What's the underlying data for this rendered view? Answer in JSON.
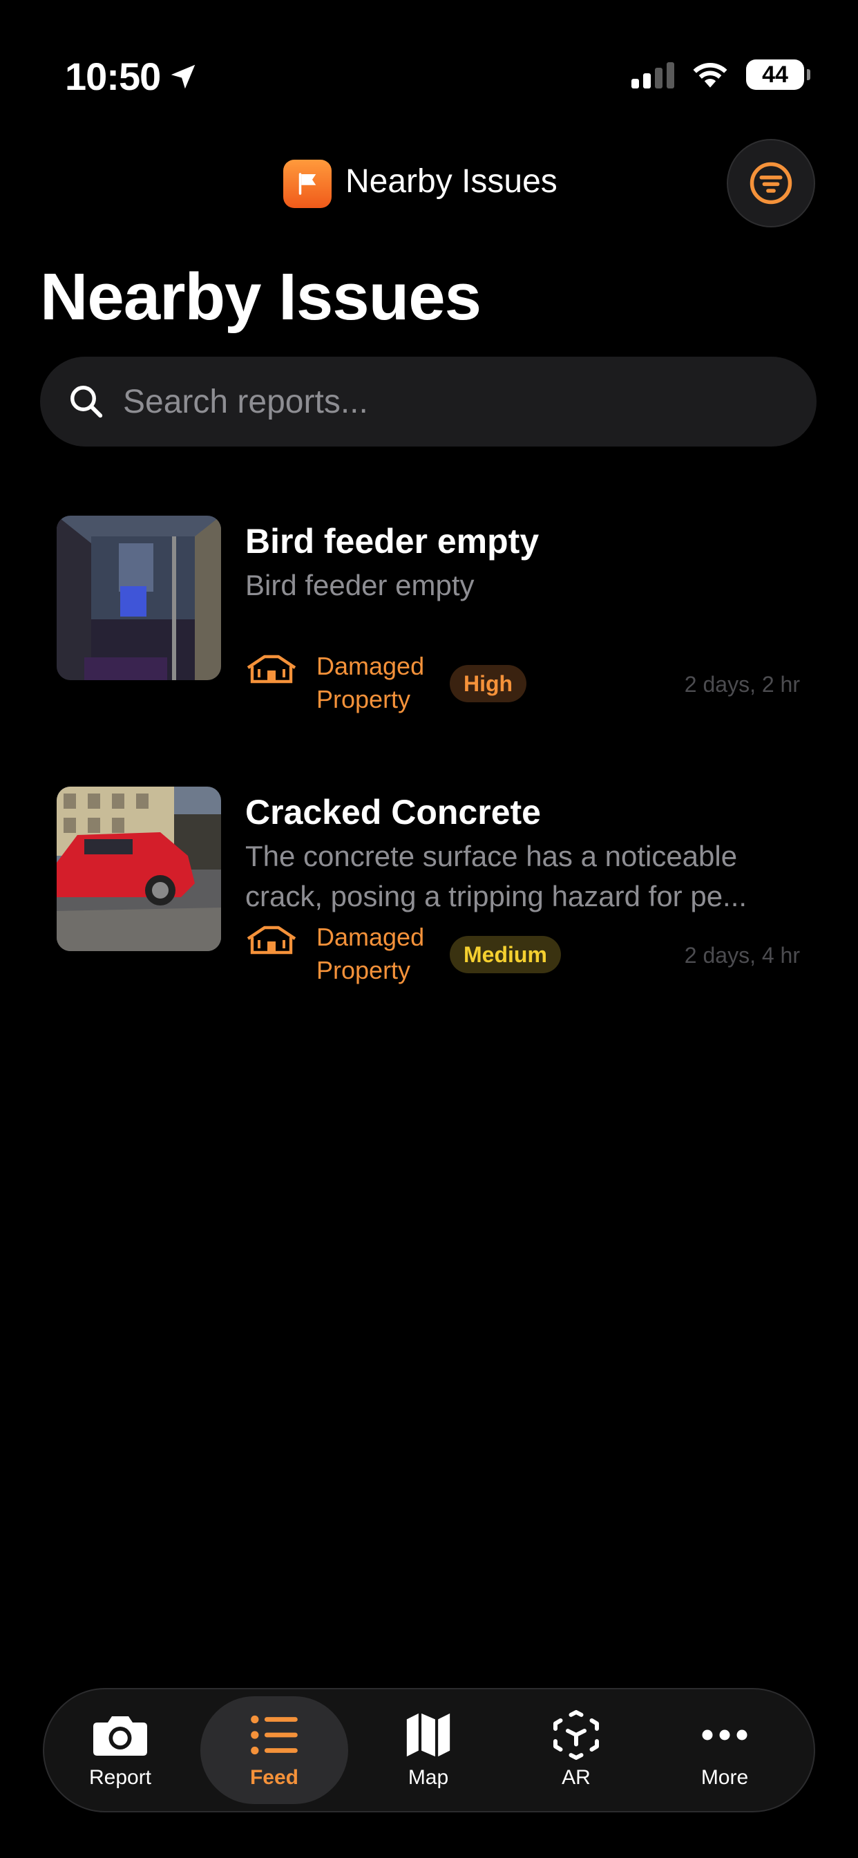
{
  "status_bar": {
    "time": "10:50",
    "battery": "44"
  },
  "header": {
    "nav_title": "Nearby Issues",
    "large_title": "Nearby Issues"
  },
  "search": {
    "placeholder": "Search reports..."
  },
  "reports": [
    {
      "title": "Bird feeder empty",
      "description": "Bird feeder empty",
      "category": "Damaged Property",
      "priority": "High",
      "time_ago": "2 days, 2 hr"
    },
    {
      "title": "Cracked Concrete",
      "description": "The concrete surface has a noticeable crack, posing a tripping hazard for pe...",
      "category": "Damaged Property",
      "priority": "Medium",
      "time_ago": "2 days, 4 hr"
    }
  ],
  "tab_bar": {
    "tabs": [
      {
        "label": "Report",
        "icon": "camera-icon"
      },
      {
        "label": "Feed",
        "icon": "list-icon",
        "active": true
      },
      {
        "label": "Map",
        "icon": "map-icon"
      },
      {
        "label": "AR",
        "icon": "ar-cube-icon"
      },
      {
        "label": "More",
        "icon": "ellipsis-icon"
      }
    ]
  },
  "colors": {
    "accent": "#f5923a",
    "background": "#000000",
    "surface": "#1c1c1e",
    "high_badge_text": "#f5923a",
    "medium_badge_text": "#f5d030"
  }
}
